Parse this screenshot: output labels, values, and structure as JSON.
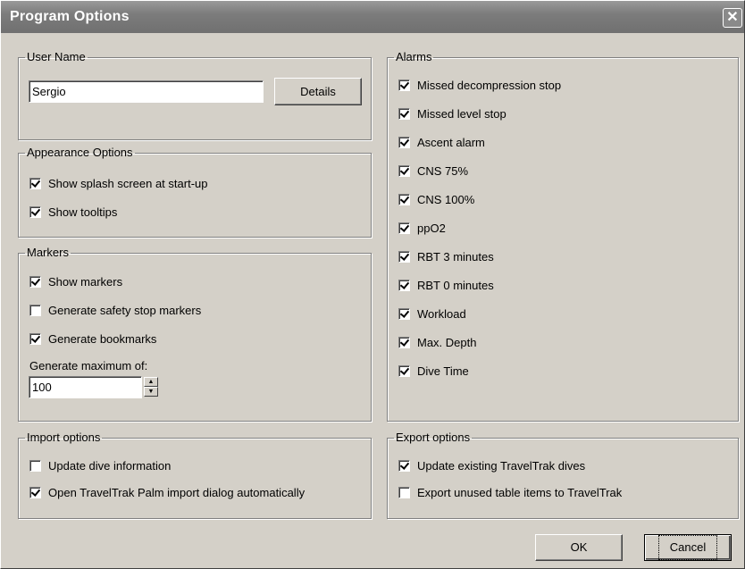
{
  "window": {
    "title": "Program Options"
  },
  "user_name": {
    "legend": "User Name",
    "value": "Sergio",
    "details_label": "Details"
  },
  "appearance": {
    "legend": "Appearance Options",
    "items": [
      {
        "label": "Show splash screen at start-up",
        "checked": true
      },
      {
        "label": "Show tooltips",
        "checked": true
      }
    ]
  },
  "markers": {
    "legend": "Markers",
    "items": [
      {
        "label": "Show markers",
        "checked": true
      },
      {
        "label": "Generate safety stop markers",
        "checked": false
      },
      {
        "label": "Generate bookmarks",
        "checked": true
      }
    ],
    "max_label": "Generate maximum of:",
    "max_value": "100"
  },
  "import": {
    "legend": "Import options",
    "items": [
      {
        "label": "Update dive information",
        "checked": false
      },
      {
        "label": "Open TravelTrak Palm import dialog automatically",
        "checked": true
      }
    ]
  },
  "alarms": {
    "legend": "Alarms",
    "items": [
      {
        "label": "Missed decompression stop",
        "checked": true
      },
      {
        "label": "Missed level stop",
        "checked": true
      },
      {
        "label": "Ascent alarm",
        "checked": true
      },
      {
        "label": "CNS 75%",
        "checked": true
      },
      {
        "label": "CNS 100%",
        "checked": true
      },
      {
        "label": "ppO2",
        "checked": true
      },
      {
        "label": "RBT 3 minutes",
        "checked": true
      },
      {
        "label": "RBT 0 minutes",
        "checked": true
      },
      {
        "label": "Workload",
        "checked": true
      },
      {
        "label": "Max. Depth",
        "checked": true
      },
      {
        "label": "Dive Time",
        "checked": true
      }
    ]
  },
  "export": {
    "legend": "Export options",
    "items": [
      {
        "label": "Update existing TravelTrak dives",
        "checked": true
      },
      {
        "label": "Export unused table items to TravelTrak",
        "checked": false
      }
    ]
  },
  "buttons": {
    "ok": "OK",
    "cancel": "Cancel"
  }
}
